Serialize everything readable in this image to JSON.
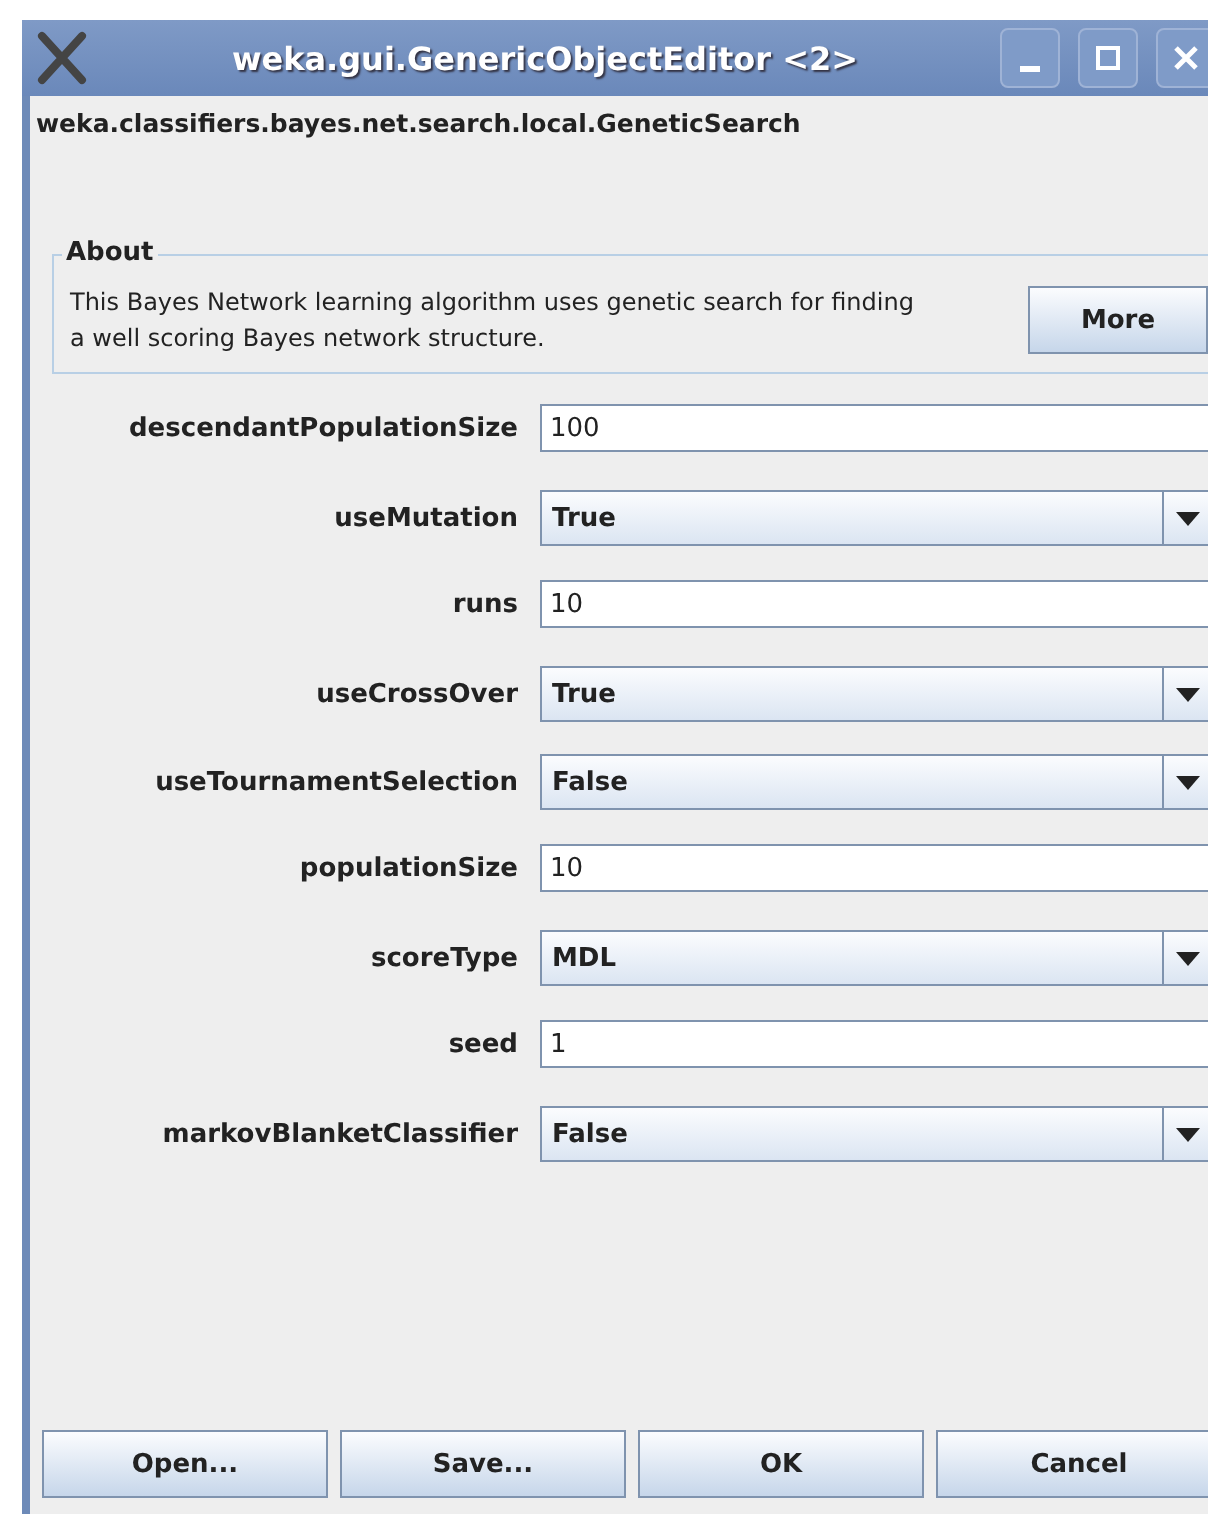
{
  "window": {
    "title": "weka.gui.GenericObjectEditor <2>"
  },
  "class_name": "weka.classifiers.bayes.net.search.local.GeneticSearch",
  "about": {
    "title": "About",
    "text": "This Bayes Network learning algorithm uses genetic search for finding a well scoring Bayes network structure.",
    "button": "More"
  },
  "properties": [
    {
      "label": "descendantPopulationSize",
      "kind": "text",
      "value": "100"
    },
    {
      "label": "useMutation",
      "kind": "choice",
      "value": "True"
    },
    {
      "label": "runs",
      "kind": "text",
      "value": "10"
    },
    {
      "label": "useCrossOver",
      "kind": "choice",
      "value": "True"
    },
    {
      "label": "useTournamentSelection",
      "kind": "choice",
      "value": "False"
    },
    {
      "label": "populationSize",
      "kind": "text",
      "value": "10"
    },
    {
      "label": "scoreType",
      "kind": "choice",
      "value": "MDL"
    },
    {
      "label": "seed",
      "kind": "text",
      "value": "1"
    },
    {
      "label": "markovBlanketClassifier",
      "kind": "choice",
      "value": "False"
    }
  ],
  "buttons": [
    "Open...",
    "Save...",
    "OK",
    "Cancel"
  ]
}
